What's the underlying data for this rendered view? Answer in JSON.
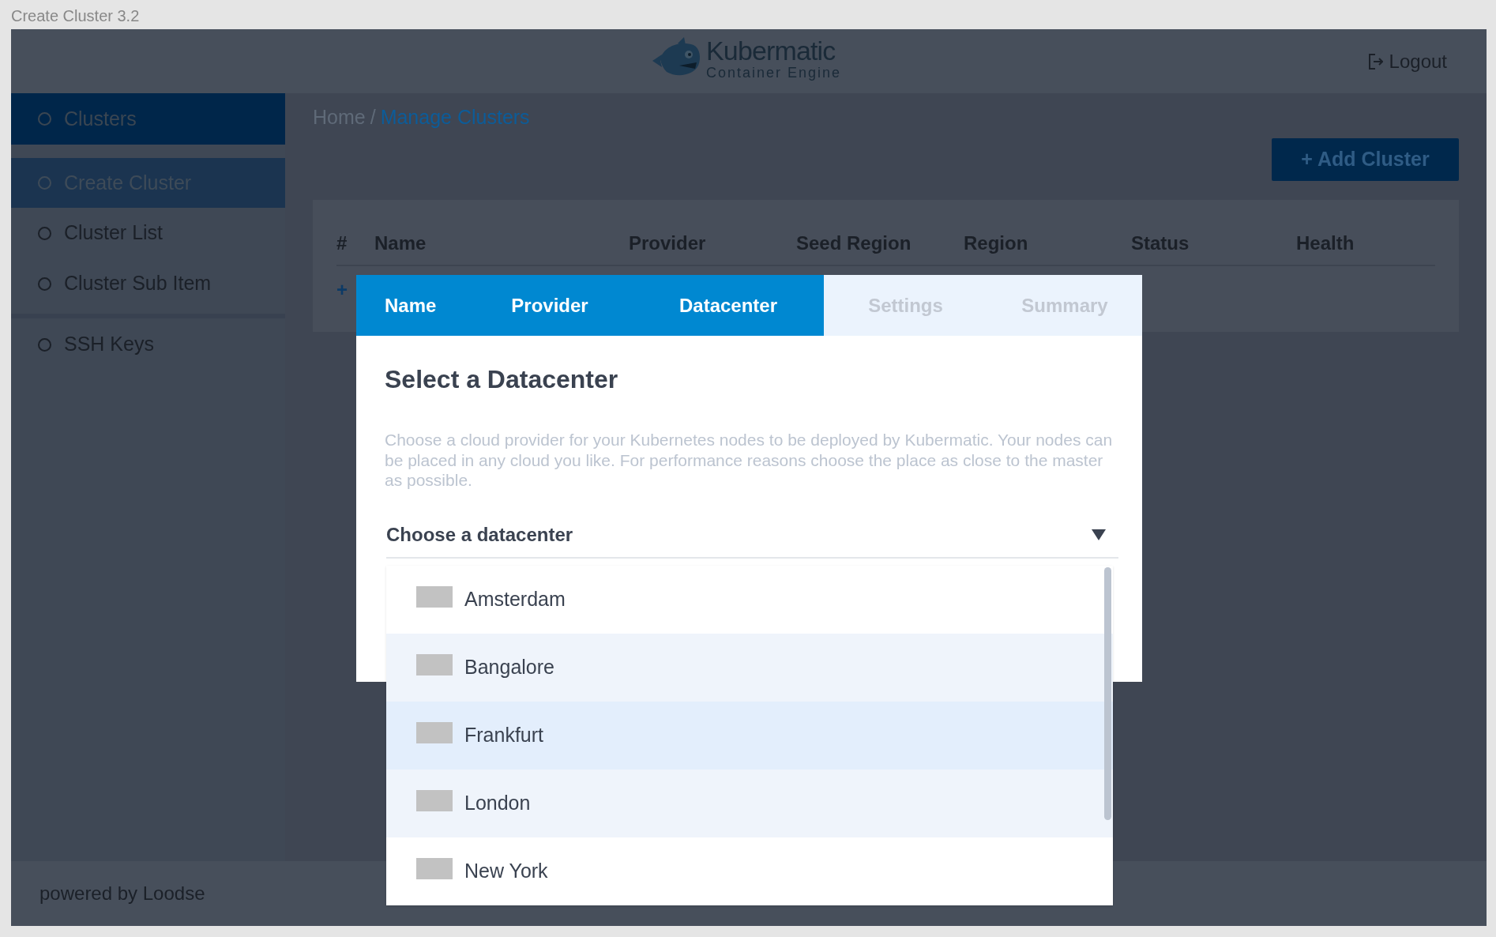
{
  "window": {
    "title": "Create Cluster 3.2"
  },
  "header": {
    "logo_title": "Kubermatic",
    "logo_subtitle": "Container Engine",
    "logout": "Logout"
  },
  "sidebar": {
    "items": [
      {
        "label": "Clusters",
        "kind": "section",
        "selected": true
      },
      {
        "label": "Create Cluster",
        "kind": "sub",
        "selected": true
      },
      {
        "label": "Cluster List",
        "kind": "sub",
        "selected": false
      },
      {
        "label": "Cluster Sub Item",
        "kind": "sub",
        "selected": false
      },
      {
        "label": "SSH Keys",
        "kind": "section",
        "selected": false
      }
    ]
  },
  "breadcrumb": {
    "separator": "/",
    "items": [
      {
        "label": "Home",
        "current": false
      },
      {
        "label": "Manage Clusters",
        "current": true
      }
    ]
  },
  "add_button": "+ Add Cluster",
  "table": {
    "columns": [
      "#",
      "Name",
      "Provider",
      "Seed Region",
      "Region",
      "Status",
      "Health"
    ],
    "add_row": "+"
  },
  "footer": "powered by Loodse",
  "dialog": {
    "tabs": [
      {
        "label": "Name",
        "disabled": false
      },
      {
        "label": "Provider",
        "disabled": false
      },
      {
        "label": "Datacenter",
        "disabled": false
      },
      {
        "label": "Settings",
        "disabled": true
      },
      {
        "label": "Summary",
        "disabled": true
      }
    ],
    "heading": "Select a Datacenter",
    "description": "Choose a cloud provider for your Kubernetes nodes to be deployed by Kubermatic. Your nodes can be placed in any cloud you like. For performance reasons choose the place as close to the master as possible.",
    "select": {
      "label": "Choose a datacenter",
      "expanded": true,
      "options": [
        {
          "label": "Amsterdam",
          "selected": false,
          "shaded": false
        },
        {
          "label": "Bangalore",
          "selected": false,
          "shaded": true
        },
        {
          "label": "Frankfurt",
          "selected": true,
          "shaded": false
        },
        {
          "label": "London",
          "selected": false,
          "shaded": true
        },
        {
          "label": "New York",
          "selected": false,
          "shaded": false
        }
      ]
    }
  }
}
